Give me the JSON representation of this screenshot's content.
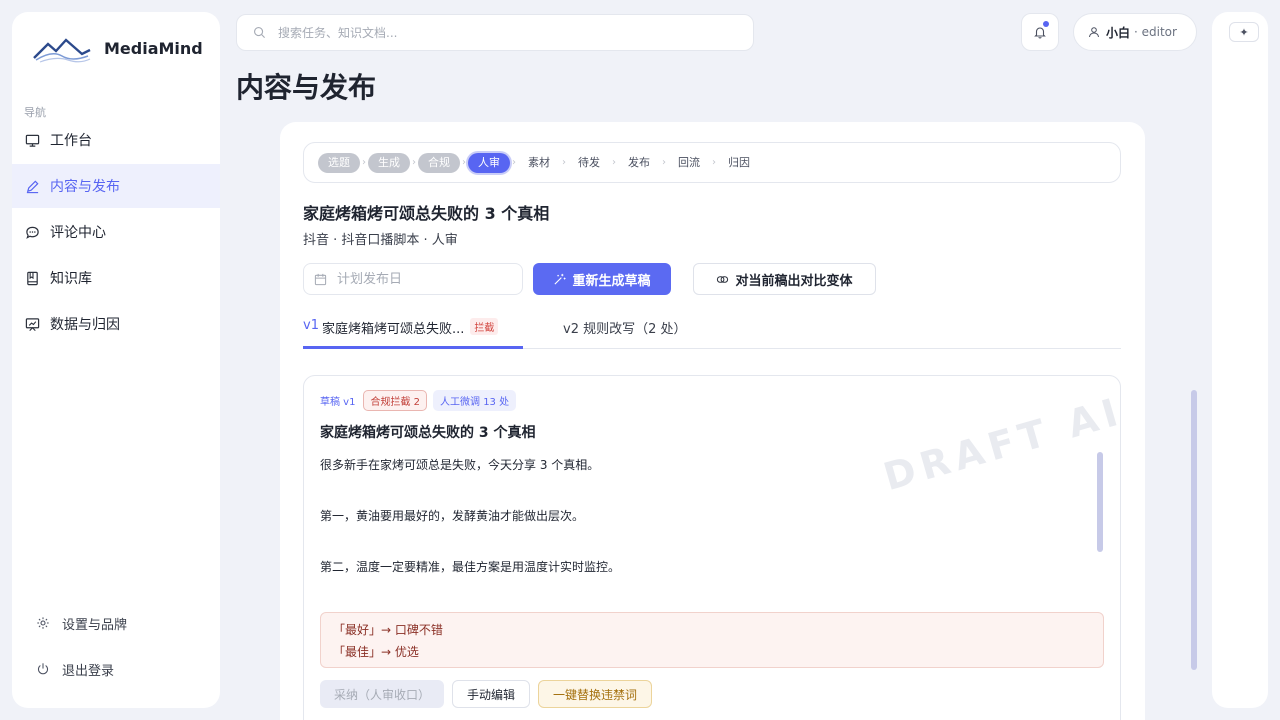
{
  "brand": {
    "name": "MediaMind",
    "logo_icon": "mountain-logo"
  },
  "sidebar": {
    "section_label": "导航",
    "items": [
      {
        "label": "工作台",
        "icon": "monitor-icon",
        "active": false
      },
      {
        "label": "内容与发布",
        "icon": "pen-icon",
        "active": true
      },
      {
        "label": "评论中心",
        "icon": "chat-icon",
        "active": false
      },
      {
        "label": "知识库",
        "icon": "book-icon",
        "active": false
      },
      {
        "label": "数据与归因",
        "icon": "chart-board-icon",
        "active": false
      }
    ],
    "bottom_items": [
      {
        "label": "设置与品牌",
        "icon": "gear-icon"
      },
      {
        "label": "退出登录",
        "icon": "power-icon"
      }
    ]
  },
  "search": {
    "placeholder": "搜索任务、知识文档..."
  },
  "user": {
    "name": "小白",
    "role": "· editor"
  },
  "page": {
    "title": "内容与发布"
  },
  "right_panel": {
    "button_glyph": "✦"
  },
  "stepper": {
    "steps": [
      {
        "label": "选题",
        "state": "done"
      },
      {
        "label": "生成",
        "state": "done"
      },
      {
        "label": "合规",
        "state": "done"
      },
      {
        "label": "人审",
        "state": "current"
      },
      {
        "label": "素材",
        "state": "todo"
      },
      {
        "label": "待发",
        "state": "todo"
      },
      {
        "label": "发布",
        "state": "todo"
      },
      {
        "label": "回流",
        "state": "todo"
      },
      {
        "label": "归因",
        "state": "todo"
      }
    ]
  },
  "document": {
    "title": "家庭烤箱烤可颂总失败的 3 个真相",
    "meta": "抖音 · 抖音口播脚本 · 人审",
    "date_placeholder": "计划发布日",
    "regenerate_label": "重新生成草稿",
    "compare_label": "对当前稿出对比变体"
  },
  "tabs": {
    "v1": {
      "version": "v1",
      "title": "家庭烤箱烤可颂总失败...",
      "badge": "拦截"
    },
    "v2": {
      "label": "v2 规则改写（2 处）"
    }
  },
  "draft": {
    "label": "草稿 v1",
    "badge_compliance": "合规拦截 2",
    "badge_manual": "人工微调 13 处",
    "title": "家庭烤箱烤可颂总失败的 3 个真相",
    "paragraphs": [
      "很多新手在家烤可颂总是失败，今天分享 3 个真相。",
      "第一，黄油要用最好的，发酵黄油才能做出层次。",
      "第二，温度一定要精准，最佳方案是用温度计实时监控。"
    ],
    "replacements": [
      "「最好」→ 口碑不错",
      "「最佳」→ 优选"
    ],
    "actions": {
      "adopt": "采纳（人审收口）",
      "manual_edit": "手动编辑",
      "replace_all": "一键替换违禁词"
    },
    "watermark": "DRAFT AI"
  },
  "colors": {
    "accent": "#5865f2",
    "danger": "#d2453f",
    "warning": "#a4700d"
  }
}
